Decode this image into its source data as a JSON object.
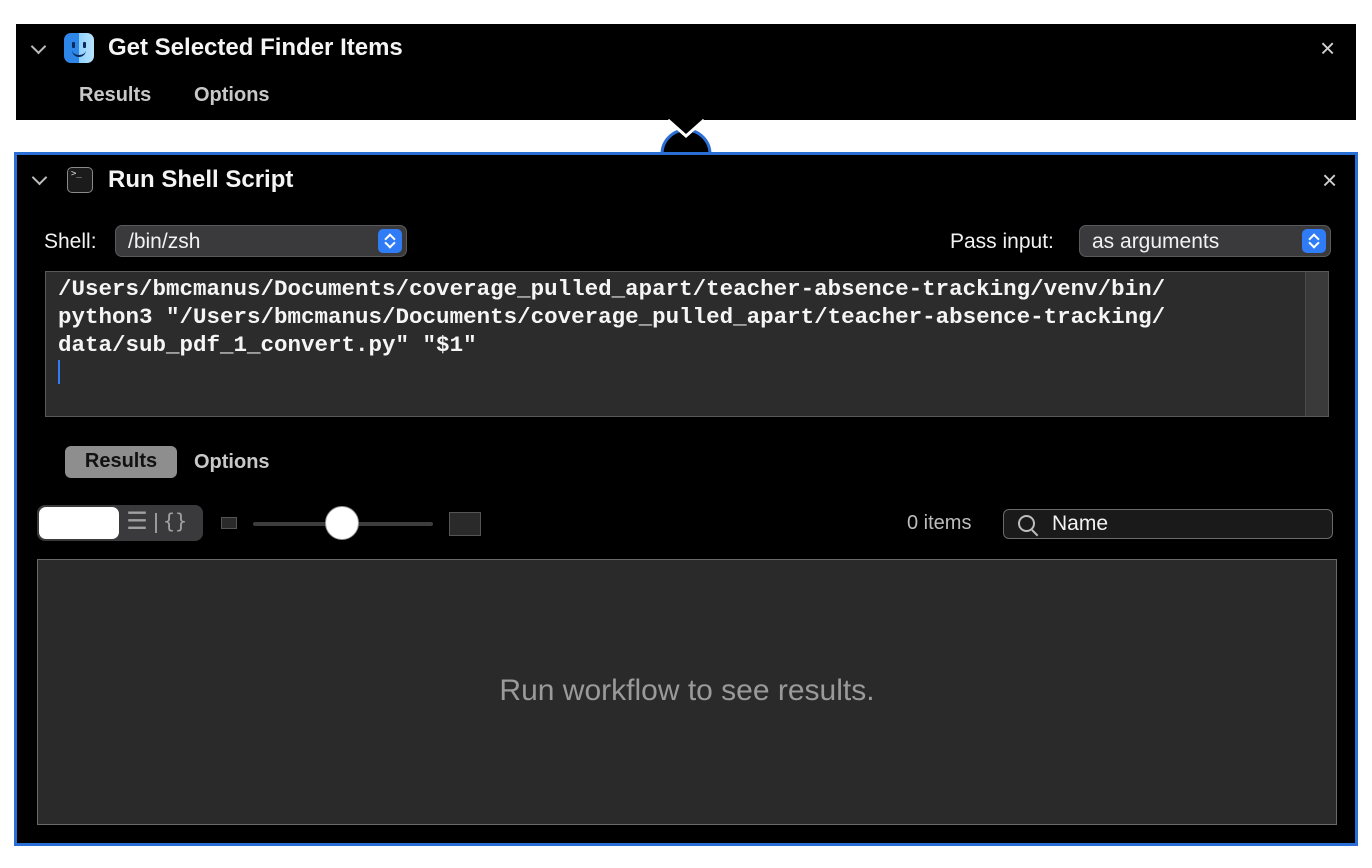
{
  "action1": {
    "title": "Get Selected Finder Items",
    "icon": "finder-icon",
    "close_glyph": "×",
    "tabs": [
      "Results",
      "Options"
    ]
  },
  "action2": {
    "title": "Run Shell Script",
    "icon": "terminal-icon",
    "close_glyph": "×",
    "shell_label": "Shell:",
    "shell_value": "/bin/zsh",
    "pass_input_label": "Pass input:",
    "pass_input_value": "as arguments",
    "script": "/Users/bmcmanus/Documents/coverage_pulled_apart/teacher-absence-tracking/venv/bin/\npython3 \"/Users/bmcmanus/Documents/coverage_pulled_apart/teacher-absence-tracking/\ndata/sub_pdf_1_convert.py\" \"$1\"",
    "tabs": [
      "Results",
      "Options"
    ],
    "active_tab": "Results",
    "view_json_glyph": "{}",
    "view_list_glyph": "☰",
    "items_count": "0 items",
    "search_placeholder": "Name",
    "results_message": "Run workflow to see results."
  },
  "colors": {
    "accent": "#2a6fd6",
    "panel_bg": "#000000",
    "editor_bg": "#2c2c2c"
  }
}
